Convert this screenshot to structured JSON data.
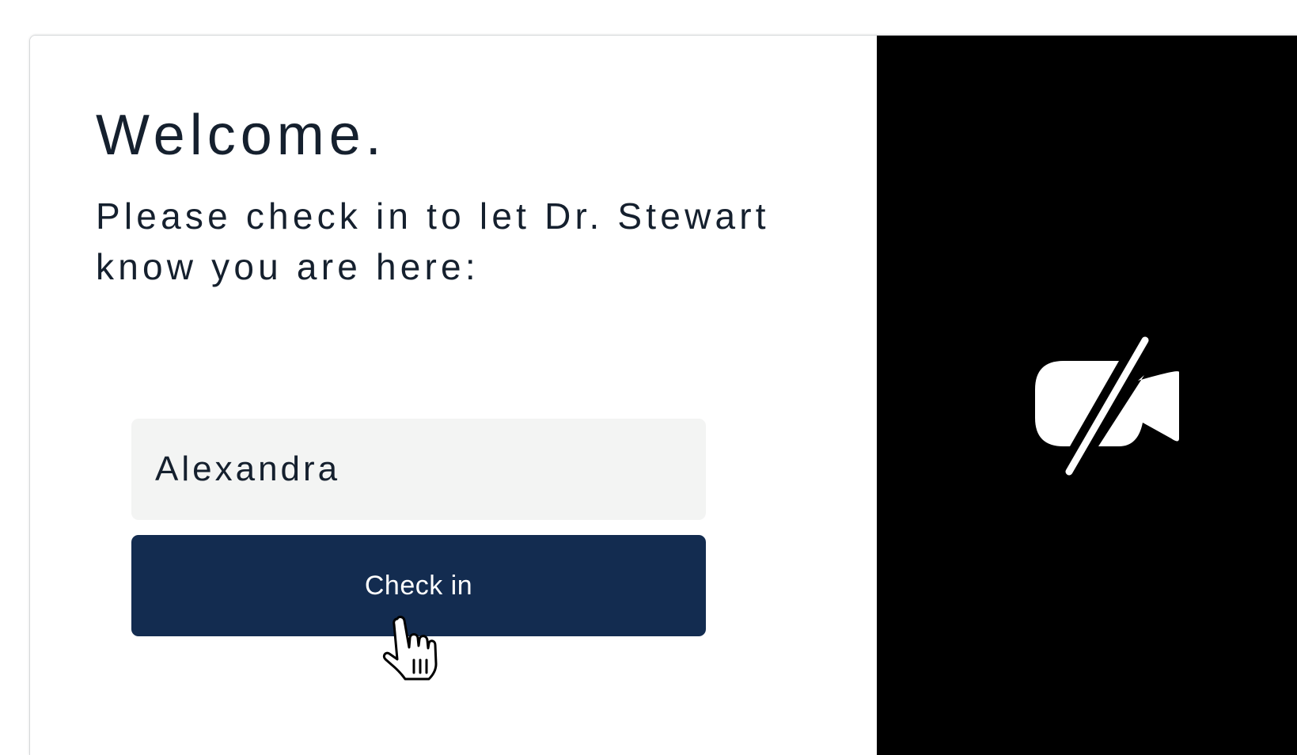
{
  "checkin": {
    "title": "Welcome.",
    "instructions": "Please check in to let Dr. Stewart know you are here:",
    "name_input_value": "Alexandra",
    "button_label": "Check in"
  },
  "video": {
    "camera_icon": "video-camera-off-icon",
    "background_color": "#000000"
  },
  "colors": {
    "primary_button": "#132c50",
    "text": "#15202e",
    "input_background": "#f3f4f3"
  },
  "cursor": {
    "icon": "hand-pointer-cursor"
  }
}
